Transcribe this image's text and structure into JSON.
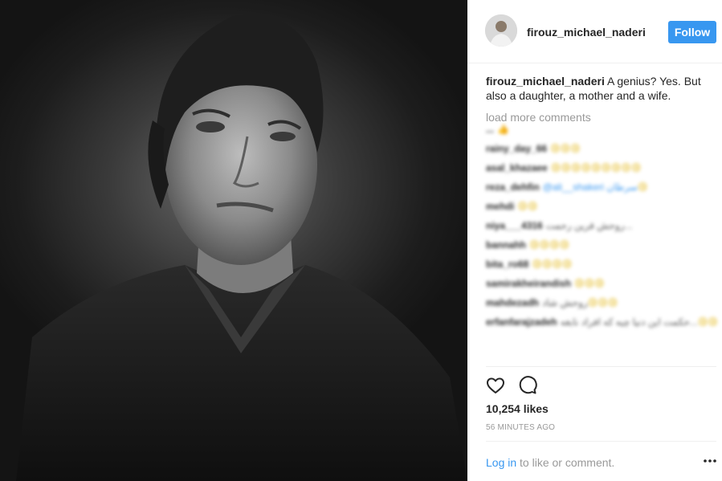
{
  "post": {
    "username": "firouz_michael_naderi",
    "follow_label": "Follow",
    "caption_user": "firouz_michael_naderi",
    "caption_text": " A genius? Yes. But also a daughter, a mother and a wife.",
    "load_more": "load more comments",
    "comments": [
      {
        "user": "...",
        "text": "",
        "emoji": "👍"
      },
      {
        "user": "rainy_day_66",
        "text": "",
        "emoji": "😢😢😢"
      },
      {
        "user": "asal_khazaee",
        "text": "",
        "emoji": "😢😢😢😢😢😢😢😢😢"
      },
      {
        "user": "reza_dehfin",
        "text": "@ali__shakeri سرطان",
        "emoji": "😢"
      },
      {
        "user": "mehdi",
        "text": "",
        "emoji": "😢😢"
      },
      {
        "user": "niya___4316",
        "text": "روحش قرین رحمت...",
        "emoji": ""
      },
      {
        "user": "bannahh",
        "text": "",
        "emoji": "😢😢😢😢"
      },
      {
        "user": "bita_ro68",
        "text": "",
        "emoji": "😢😢😢😢"
      },
      {
        "user": "samirakheirandish",
        "text": "",
        "emoji": "😢😢😢"
      },
      {
        "user": "mahdezadh",
        "text": "روحش شاد",
        "emoji": "😢😢😢"
      },
      {
        "user": "erfanfarajzadeh",
        "text": "حکمت این دنیا چیه که افراد نابغه...",
        "emoji": "😢😢"
      }
    ],
    "likes": "10,254 likes",
    "time": "56 MINUTES AGO",
    "login_link": "Log in",
    "login_rest": " to like or comment."
  }
}
